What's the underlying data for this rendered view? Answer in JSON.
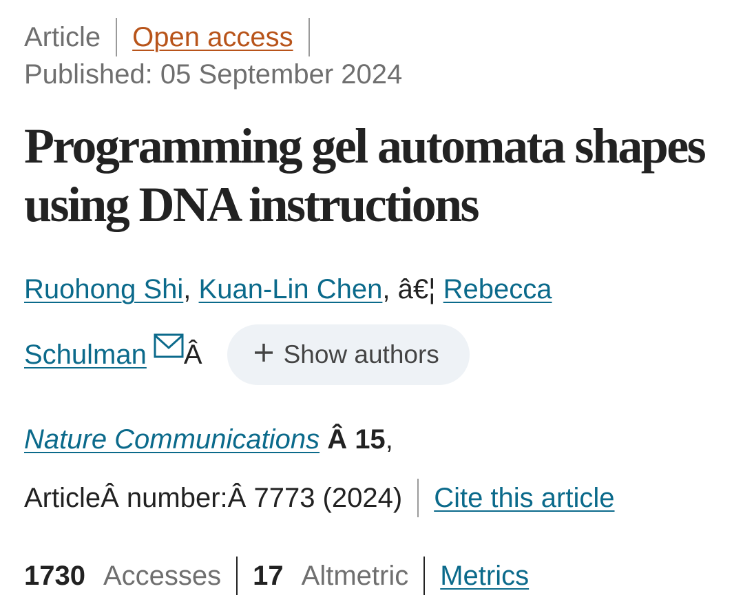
{
  "header": {
    "article_type": "Article",
    "open_access": "Open access",
    "published": "Published: 05 September 2024"
  },
  "title": "Programming gel automata shapes using DNA instructions",
  "authors": {
    "first": "Ruohong Shi",
    "second": "Kuan-Lin Chen",
    "ellipsis": "â€¦",
    "last": "Rebecca Schulman",
    "trailing": "Â",
    "show_authors_label": "Show authors"
  },
  "citation": {
    "journal": "Nature Communications",
    "volume": "Â 15",
    "article_number_text": "ArticleÂ number:Â 7773 (2024)",
    "cite_link": "Cite this article"
  },
  "metrics": {
    "accesses_count": "1730",
    "accesses_label": "Accesses",
    "altmetric_count": "17",
    "altmetric_label": "Altmetric",
    "metrics_link": "Metrics"
  },
  "icons": {
    "mail": "mail-icon",
    "plus": "plus-icon"
  },
  "colors": {
    "open_access": "#b8541a",
    "link": "#0b6a8b",
    "muted_text": "#6f6f6f",
    "chip_background": "#eef2f6"
  }
}
